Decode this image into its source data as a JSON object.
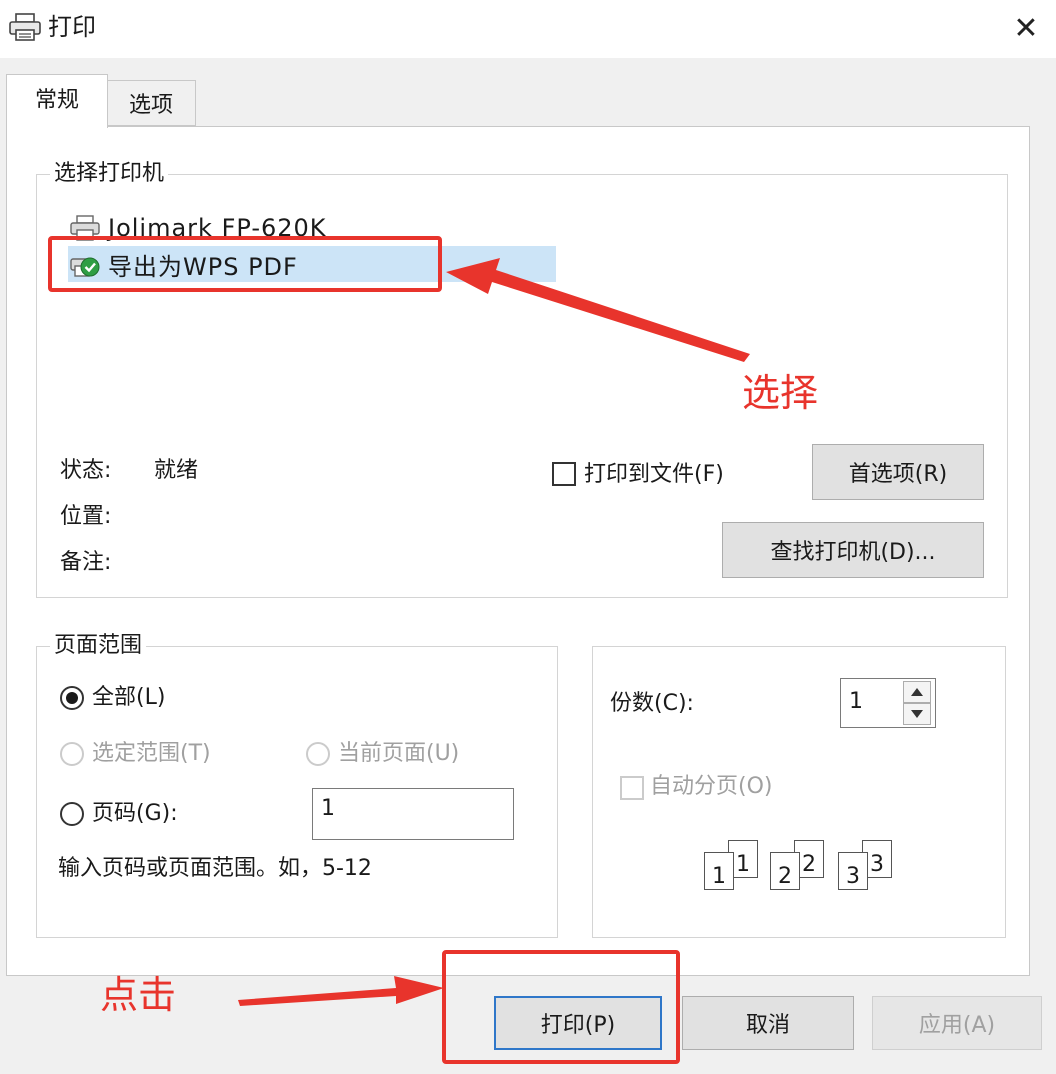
{
  "window": {
    "title": "打印",
    "close_glyph": "✕"
  },
  "tabs": [
    {
      "label": "常规",
      "active": true
    },
    {
      "label": "选项",
      "active": false
    }
  ],
  "printer_group": {
    "title": "选择打印机",
    "printers": [
      {
        "name": "Jolimark FP-620K",
        "icon": "printer-icon"
      },
      {
        "name": "导出为WPS PDF",
        "icon": "printer-default-icon",
        "selected": true
      }
    ],
    "status_label": "状态:",
    "status_value": "就绪",
    "location_label": "位置:",
    "comment_label": "备注:",
    "print_to_file_label": "打印到文件(F)",
    "preferences_label": "首选项(R)",
    "find_printer_label": "查找打印机(D)..."
  },
  "page_range": {
    "title": "页面范围",
    "all_label": "全部(L)",
    "selection_label": "选定范围(T)",
    "current_page_label": "当前页面(U)",
    "pages_label": "页码(G):",
    "pages_value": "1",
    "hint": "输入页码或页面范围。如，5-12"
  },
  "copies": {
    "label": "份数(C):",
    "value": "1",
    "collate_label": "自动分页(O)",
    "collate_pages": [
      "1",
      "1",
      "2",
      "2",
      "3",
      "3"
    ]
  },
  "buttons": {
    "print": "打印(P)",
    "cancel": "取消",
    "apply": "应用(A)"
  },
  "annotations": {
    "select_note": "选择",
    "click_note": "点击"
  },
  "colors": {
    "annotation_red": "#e8342c",
    "selection_blue": "#cce4f7",
    "default_button_border": "#2f77c9"
  }
}
